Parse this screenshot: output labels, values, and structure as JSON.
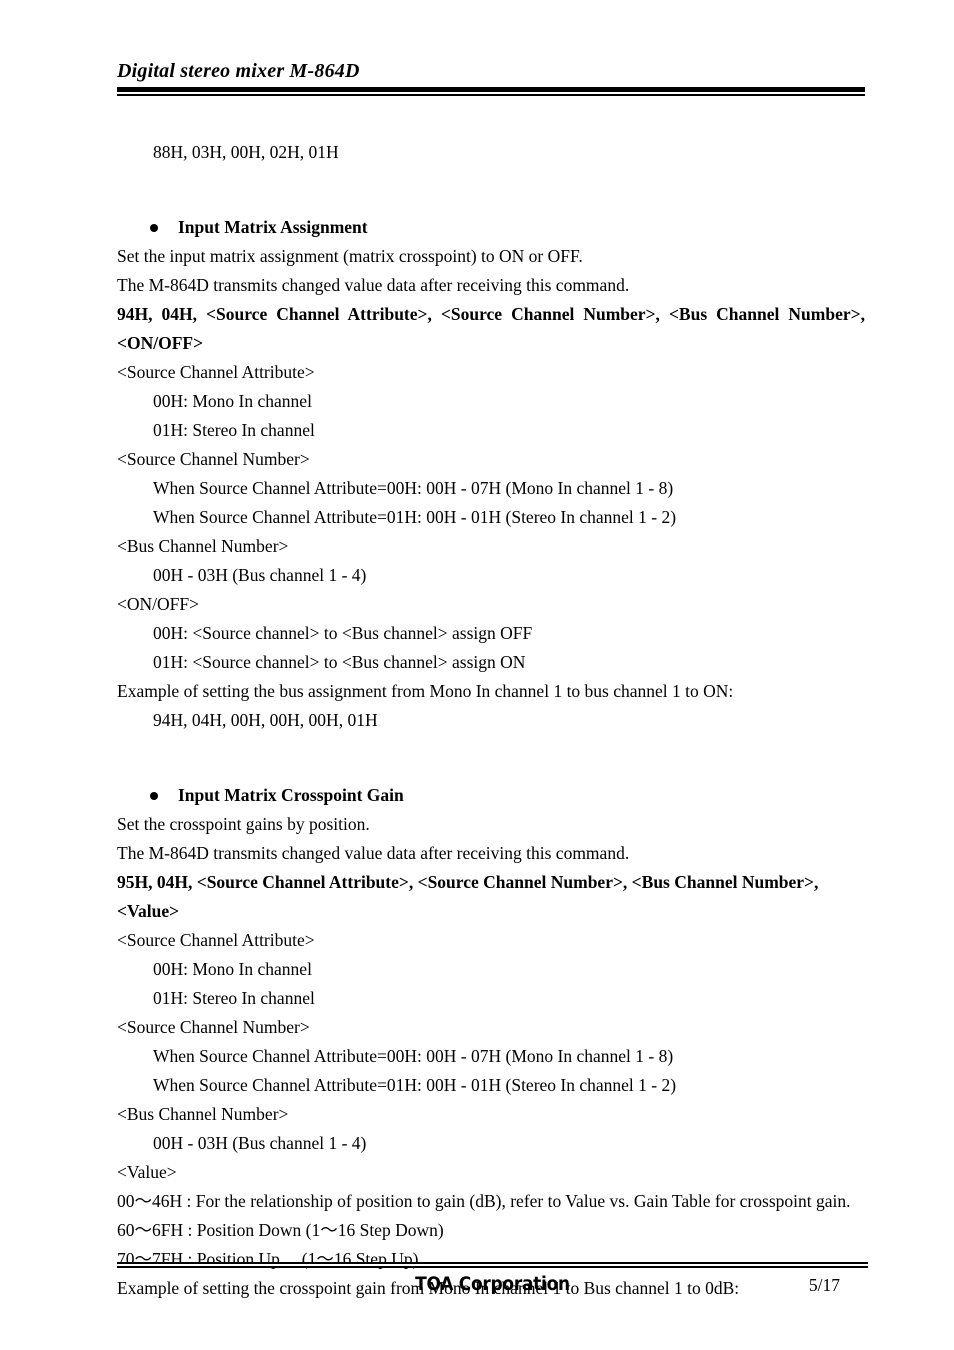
{
  "document": {
    "header_title": "Digital stereo mixer M-864D",
    "footer_company": "TOA Corporation",
    "footer_page": "5/17"
  },
  "body": {
    "preceding_example": "88H, 03H, 00H, 02H, 01H",
    "sections": [
      {
        "heading": "Input Matrix Assignment",
        "intro_1": "Set the input matrix assignment (matrix crosspoint) to ON or OFF.",
        "intro_2": "The M-864D transmits changed value data after receiving this command.",
        "command": "94H, 04H, <Source Channel Attribute>, <Source Channel Number>, <Bus Channel Number>, <ON/OFF>",
        "params": [
          {
            "name": "<Source Channel Attribute>",
            "values": [
              "00H: Mono In channel",
              "01H: Stereo In channel"
            ]
          },
          {
            "name": "<Source Channel Number>",
            "values": [
              "When Source Channel Attribute=00H: 00H - 07H (Mono In channel 1 - 8)",
              "When Source Channel Attribute=01H: 00H - 01H (Stereo In channel 1 - 2)"
            ]
          },
          {
            "name": "<Bus Channel Number>",
            "values": [
              "00H - 03H (Bus channel 1 - 4)"
            ]
          },
          {
            "name": "<ON/OFF>",
            "values": [
              "00H: <Source channel> to <Bus channel> assign OFF",
              "01H: <Source channel> to <Bus channel> assign ON"
            ]
          }
        ],
        "example_label": "Example of setting the bus assignment from Mono In channel 1 to bus channel 1 to ON:",
        "example_value": "94H, 04H, 00H, 00H, 00H, 01H"
      },
      {
        "heading": "Input Matrix Crosspoint Gain",
        "intro_1": "Set the crosspoint gains by position.",
        "intro_2": "The M-864D transmits changed value data after receiving this command.",
        "command": "95H, 04H, <Source Channel Attribute>, <Source Channel Number>, <Bus Channel Number>, <Value>",
        "params": [
          {
            "name": "<Source Channel Attribute>",
            "values": [
              "00H: Mono In channel",
              "01H: Stereo In channel"
            ]
          },
          {
            "name": "<Source Channel Number>",
            "values": [
              "When Source Channel Attribute=00H: 00H - 07H (Mono In channel 1 - 8)",
              "When Source Channel Attribute=01H: 00H - 01H (Stereo In channel 1 - 2)"
            ]
          },
          {
            "name": "<Bus Channel Number>",
            "values": [
              "00H - 03H (Bus channel 1 - 4)"
            ]
          },
          {
            "name": "<Value>",
            "values": []
          }
        ],
        "value_lines": [
          "00〜46H : For the relationship of position to gain (dB), refer to Value vs. Gain Table for crosspoint gain.",
          "60〜6FH : Position Down (1〜16 Step Down)",
          "70〜7FH : Position Up     (1〜16 Step Up)"
        ],
        "example_label": "Example of setting the crosspoint gain from Mono In channel 1 to Bus channel 1 to 0dB:"
      }
    ]
  }
}
